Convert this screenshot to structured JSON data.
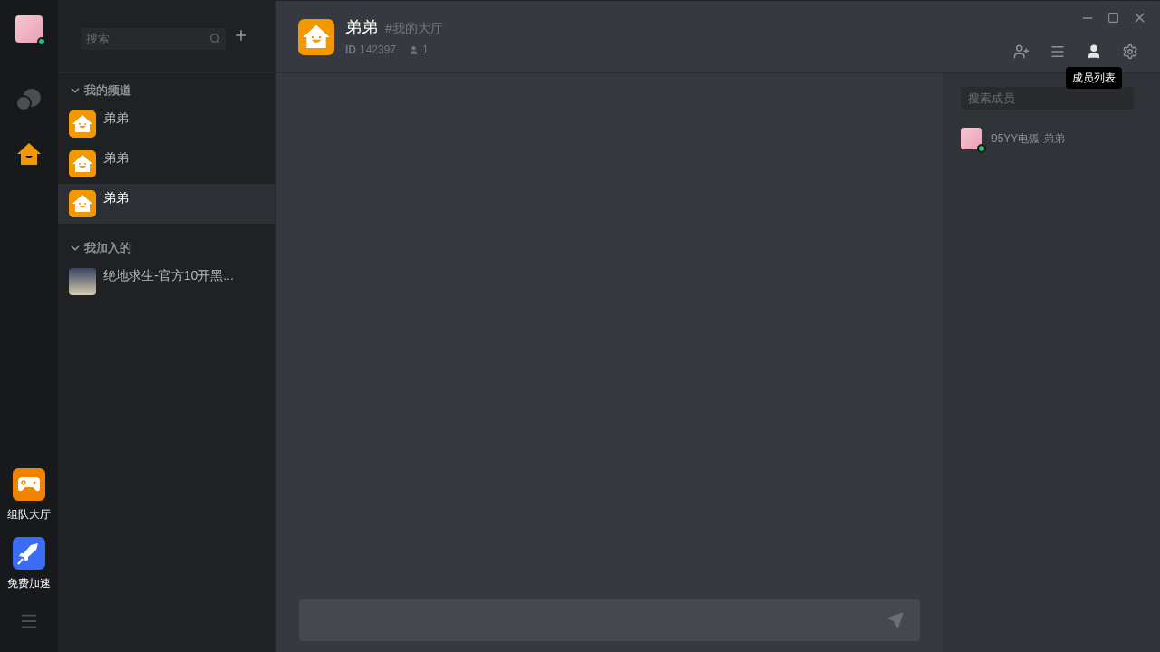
{
  "user": {
    "online": true
  },
  "rail": [
    {
      "kind": "chat",
      "selected": false
    },
    {
      "kind": "house",
      "selected": true
    }
  ],
  "apps": [
    {
      "kind": "game",
      "label": "组队大厅"
    },
    {
      "kind": "rocket",
      "label": "免费加速"
    }
  ],
  "channel_search": {
    "placeholder": "搜索"
  },
  "sections": [
    {
      "title": "我的频道",
      "expanded": true,
      "items": [
        {
          "kind": "house",
          "name": "弟弟",
          "selected": false
        },
        {
          "kind": "house",
          "name": "弟弟",
          "selected": false
        },
        {
          "kind": "house",
          "name": "弟弟",
          "selected": true
        }
      ]
    },
    {
      "title": "我加入的",
      "expanded": true,
      "items": [
        {
          "kind": "photo",
          "name": "绝地求生-官方10开黑...",
          "selected": false
        }
      ]
    }
  ],
  "header": {
    "name": "弟弟",
    "channel": "#我的大厅",
    "id_label": "ID",
    "id": "142397",
    "members": "1"
  },
  "toolbar": [
    {
      "kind": "add-user",
      "selected": false
    },
    {
      "kind": "menu",
      "selected": false
    },
    {
      "kind": "members",
      "selected": true
    },
    {
      "kind": "settings",
      "selected": false
    }
  ],
  "tooltip": "成员列表",
  "member_search": {
    "placeholder": "搜索成员"
  },
  "members": [
    {
      "name": "95YY电狐-弟弟",
      "online": true
    }
  ]
}
